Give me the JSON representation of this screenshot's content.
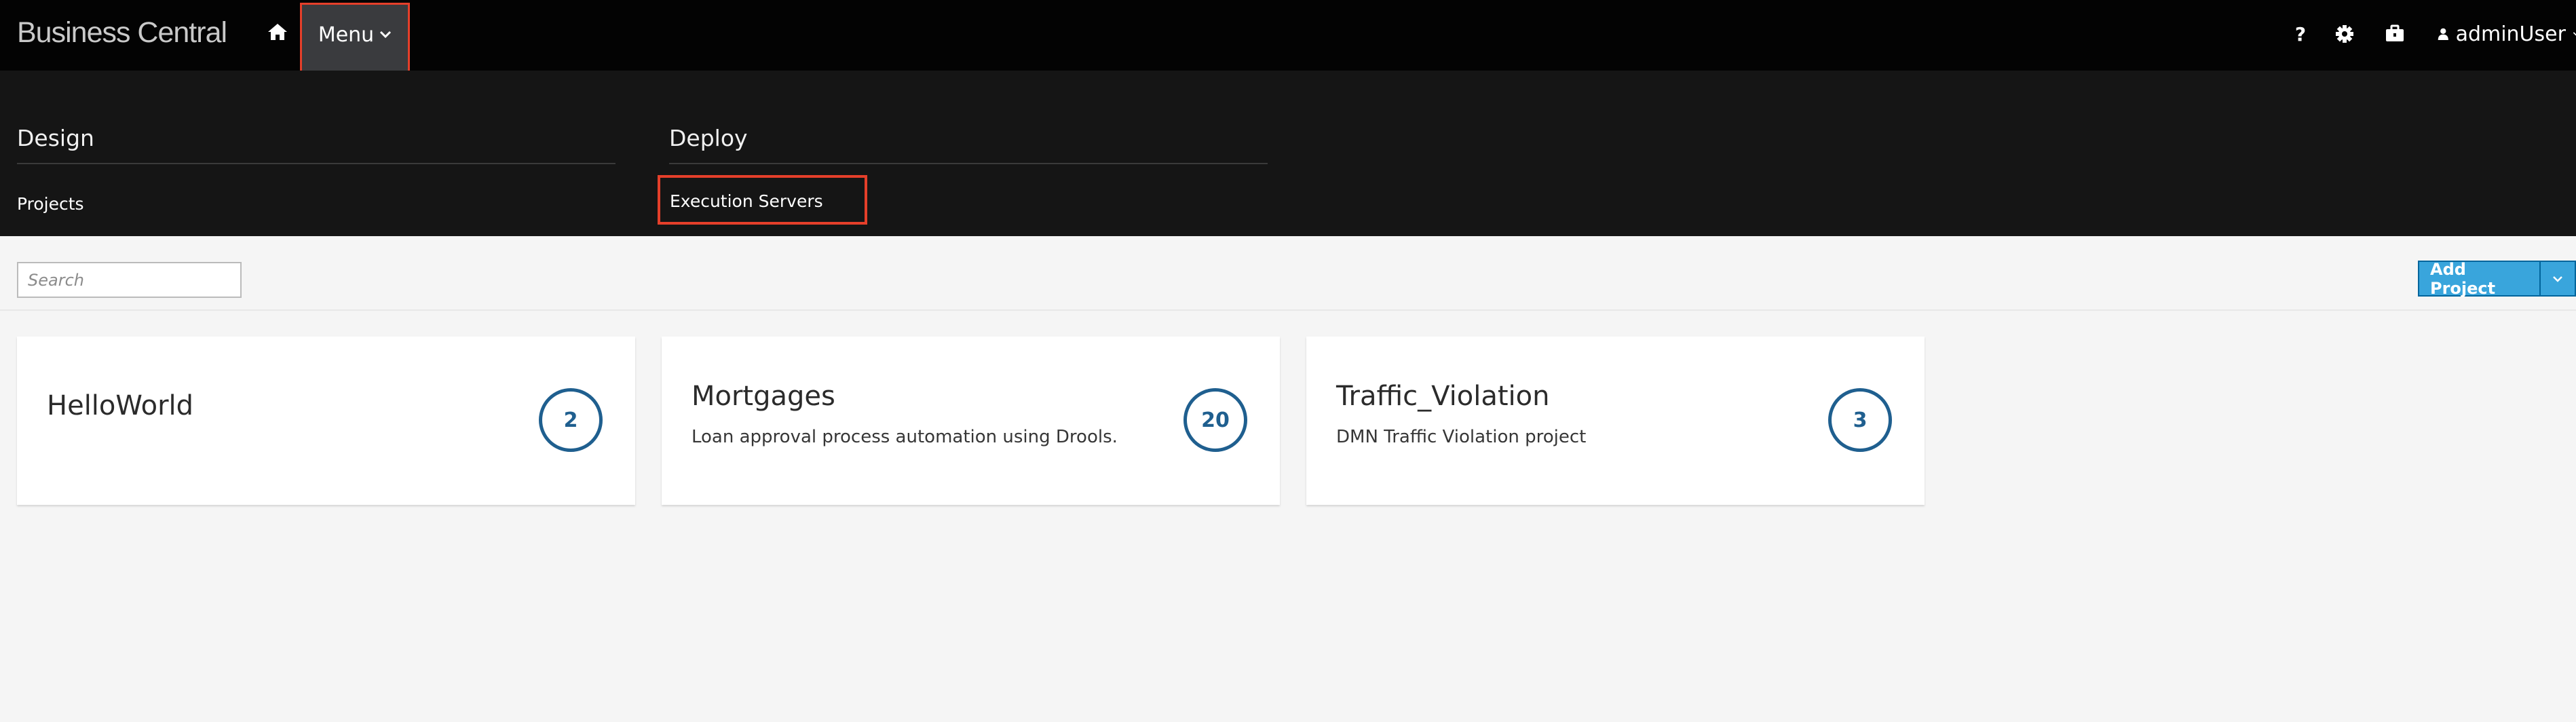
{
  "navbar": {
    "brand": "Business Central",
    "home_icon": "home-icon",
    "menu_label": "Menu",
    "help_label": "?",
    "settings_icon": "gear-icon",
    "briefcase_icon": "briefcase-icon",
    "user_label": "adminUser"
  },
  "mega_menu": {
    "columns": [
      {
        "title": "Design",
        "items": [
          "Projects"
        ]
      },
      {
        "title": "Deploy",
        "items": [
          "Execution Servers"
        ]
      }
    ]
  },
  "toolbar": {
    "search_placeholder": "Search",
    "add_project_label": "Add Project"
  },
  "projects": [
    {
      "name": "HelloWorld",
      "description": "",
      "asset_count": "2"
    },
    {
      "name": "Mortgages",
      "description": "Loan approval process automation using Drools.",
      "asset_count": "20"
    },
    {
      "name": "Traffic_Violation",
      "description": "DMN Traffic Violation project",
      "asset_count": "3"
    }
  ],
  "colors": {
    "navbar_bg": "#030303",
    "megamenu_bg": "#151515",
    "highlight_border": "#e53f2a",
    "primary_button": "#39a5dc",
    "count_circle": "#1f5f8f"
  }
}
